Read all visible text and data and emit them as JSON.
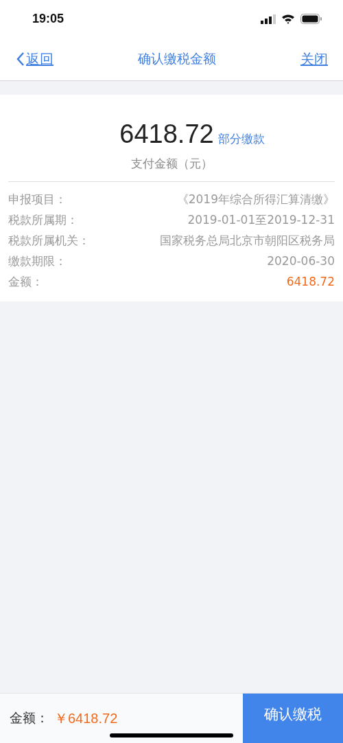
{
  "status_bar": {
    "time": "19:05"
  },
  "nav": {
    "back": "返回",
    "title": "确认缴税金额",
    "close": "关闭"
  },
  "summary": {
    "amount": "6418.72",
    "tag": "部分缴款",
    "caption": "支付金额（元）"
  },
  "details": [
    {
      "label": "申报项目：",
      "value": "《2019年综合所得汇算清缴》",
      "kind": "plain"
    },
    {
      "label": "税款所属期：",
      "value": "2019-01-01至2019-12-31",
      "kind": "plain"
    },
    {
      "label": "税款所属机关：",
      "value": "国家税务总局北京市朝阳区税务局",
      "kind": "plain"
    },
    {
      "label": "缴款期限：",
      "value": "2020-06-30",
      "kind": "plain"
    },
    {
      "label": "金额：",
      "value": "6418.72",
      "kind": "amount"
    }
  ],
  "footer": {
    "label": "金额：",
    "amount": "￥6418.72",
    "button": "确认缴税"
  }
}
